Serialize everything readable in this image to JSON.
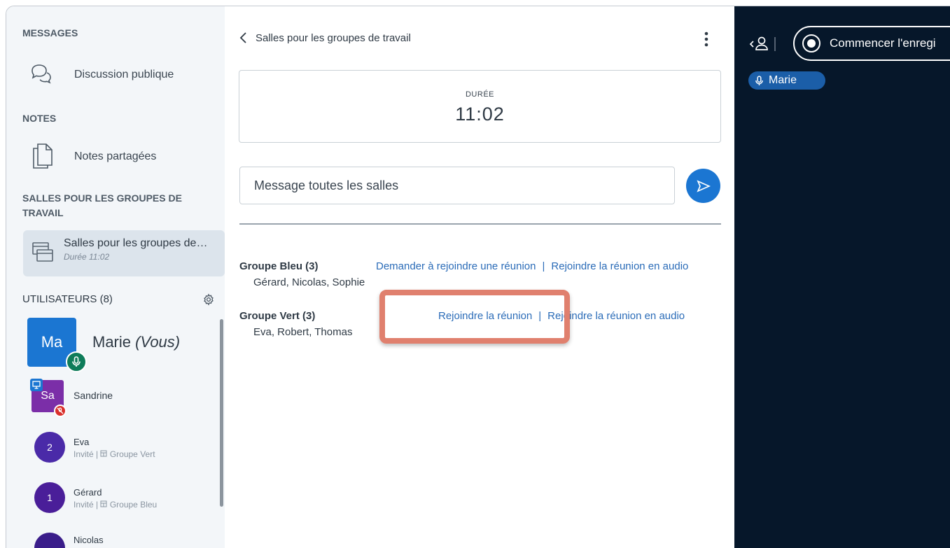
{
  "sidebar": {
    "messages_title": "MESSAGES",
    "public_chat_label": "Discussion publique",
    "notes_title": "NOTES",
    "shared_notes_label": "Notes partagées",
    "breakout_title_line1": "SALLES POUR LES GROUPES DE",
    "breakout_title_line2": "TRAVAIL",
    "breakout_item_title": "Salles pour les groupes de…",
    "breakout_item_sub": "Durée 11:02",
    "users_title": "UTILISATEURS (8)",
    "users": [
      {
        "initials": "Ma",
        "name": "Marie",
        "suffix": "(Vous)",
        "color": "#1b76d2"
      },
      {
        "initials": "Sa",
        "name": "Sandrine",
        "color": "#6f2da8"
      },
      {
        "initials": "2",
        "name": "Eva",
        "meta_role": "Invité |",
        "meta_group": "Groupe Vert",
        "color": "#4a2aa8"
      },
      {
        "initials": "1",
        "name": "Gérard",
        "meta_role": "Invité |",
        "meta_group": "Groupe Bleu",
        "color": "#4a1e99"
      },
      {
        "name": "Nicolas",
        "color": "#3a1d8a"
      }
    ]
  },
  "main": {
    "panel_title": "Salles pour les groupes de travail",
    "timer_label": "DURÉE",
    "timer_value": "11:02",
    "message_placeholder": "Message toutes les salles",
    "groups": [
      {
        "name": "Groupe Bleu (3)",
        "members": "Gérard, Nicolas, Sophie",
        "link1": "Demander à rejoindre une réunion",
        "link2": "Rejoindre la réunion en audio"
      },
      {
        "name": "Groupe Vert (3)",
        "members": "Eva, Robert, Thomas",
        "link1": "Rejoindre la réunion",
        "link2": "Rejoindre la réunion en audio"
      }
    ]
  },
  "right_panel": {
    "record_label": "Commencer l'enregi",
    "talking_name": "Marie"
  },
  "colors": {
    "accent": "#1b76d2",
    "link": "#2b6cb8",
    "highlight": "#e0806e",
    "dark_panel": "#06172a"
  }
}
